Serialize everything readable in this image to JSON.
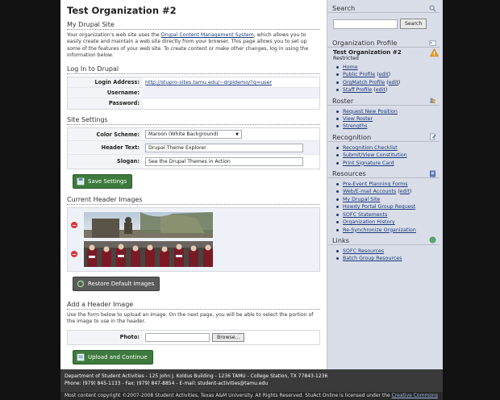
{
  "main": {
    "org_title": "Test Organization #2",
    "mydrupal": {
      "heading": "My Drupal Site",
      "intro_before": "Your organization's web site uses the ",
      "intro_link": "Drupal Content Management System",
      "intro_after": ", which allows you to easily create and maintain a web site directly from your browser. This page allows you to set up some of the features of your web site. To create content or make other changes, log in using the information below."
    },
    "login": {
      "heading": "Log In to Drupal",
      "address_label": "Login Address:",
      "address_value": "http://stupro-sites.tamu.edu/~drpldemo/?q=user",
      "username_label": "Username:",
      "username_value": "",
      "password_label": "Password:",
      "password_value": ""
    },
    "site_settings": {
      "heading": "Site Settings",
      "color_label": "Color Scheme:",
      "color_value": "Maroon (White Background)",
      "header_text_label": "Header Text:",
      "header_text_value": "Drupal Theme Explorer",
      "slogan_label": "Slogan:",
      "slogan_value": "See the Drupal Themes in Action",
      "save_button": "Save Settings"
    },
    "current_images": {
      "heading": "Current Header Images",
      "restore_button": "Restore Default Images"
    },
    "add_image": {
      "heading": "Add a Header Image",
      "intro": "Use the form below to upload an image. On the next page, you will be able to select the portion of the image to use in the header.",
      "photo_label": "Photo:",
      "browse_button": "Browse...",
      "upload_button": "Upload and Continue"
    }
  },
  "sidebar": {
    "search": {
      "heading": "Search",
      "button": "Search",
      "placeholder": ""
    },
    "org_profile": {
      "heading": "Organization Profile",
      "org_name": "Test Organization #2",
      "status": "Restricted",
      "items": [
        {
          "label": "Home",
          "edit": ""
        },
        {
          "label": "Public Profile",
          "edit": "edit"
        },
        {
          "label": "OrgMatch Profile",
          "edit": "edit"
        },
        {
          "label": "Staff Profile",
          "edit": "edit"
        }
      ]
    },
    "roster": {
      "heading": "Roster",
      "items": [
        "Request New Position",
        "View Roster",
        "Strengths"
      ]
    },
    "recognition": {
      "heading": "Recognition",
      "items": [
        "Recognition Checklist",
        "Submit/View Constitution",
        "Print Signature Card"
      ]
    },
    "resources": {
      "heading": "Resources",
      "items": [
        {
          "label": "Pre-Event Planning Forms",
          "edit": ""
        },
        {
          "label": "Web/E-mail Accounts",
          "edit": "edit"
        },
        {
          "label": "My Drupal Site",
          "edit": ""
        },
        {
          "label": "Howdy Portal Group Request",
          "edit": ""
        },
        {
          "label": "SOFC Statements",
          "edit": ""
        },
        {
          "label": "Organization History",
          "edit": ""
        },
        {
          "label": "Re-Synchronize Organization",
          "edit": ""
        }
      ]
    },
    "links": {
      "heading": "Links",
      "items": [
        "SOFC Resources",
        "Batch Group Resources"
      ]
    }
  },
  "footer": {
    "line1": "Department of Student Activities - 125 John J. Koldus Building - 1236 TAMU - College Station, TX 77843-1236",
    "line2": "Phone: (979) 845-1133 - Fax: (979) 847-8854 - E-mail: student-activities@tamu.edu",
    "line3_before": "Most content copyright ©2007-2008 Student Activities, Texas A&M University. All Rights Reserved. StuAct Online is licensed under the ",
    "line3_link": "Creative Commons"
  },
  "colors": {
    "accent_green": "#3e7a3e",
    "sidebar_bg": "#d9dde8",
    "link": "#1a3a7a",
    "warning": "#f0a020"
  }
}
